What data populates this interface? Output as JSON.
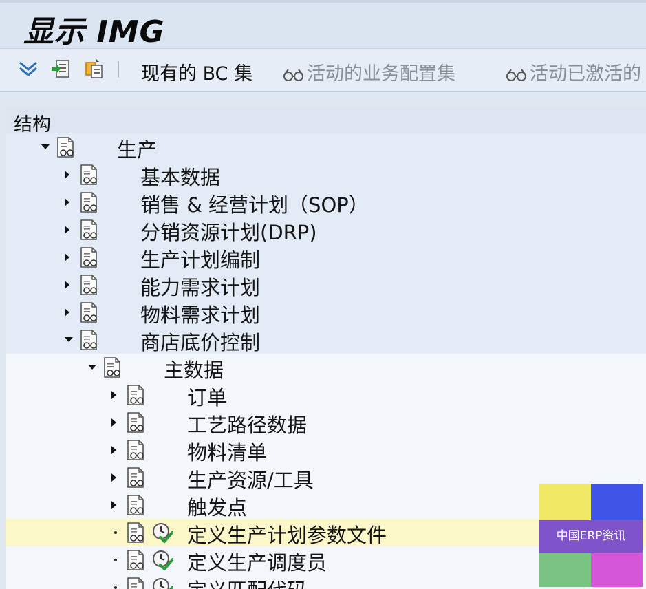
{
  "window": {
    "title": "显示 IMG"
  },
  "toolbar": {
    "existing_bc_sets": "现有的 BC 集",
    "active_business_config_sets": "活动的业务配置集",
    "activated_active": "活动已激活的"
  },
  "tree": {
    "header": "结构",
    "nodes": [
      {
        "label": "生产"
      },
      {
        "label": "基本数据"
      },
      {
        "label": "销售 & 经营计划（SOP）"
      },
      {
        "label": "分销资源计划(DRP)"
      },
      {
        "label": "生产计划编制"
      },
      {
        "label": "能力需求计划"
      },
      {
        "label": "物料需求计划"
      },
      {
        "label": "商店底价控制"
      },
      {
        "label": "主数据"
      },
      {
        "label": "订单"
      },
      {
        "label": "工艺路径数据"
      },
      {
        "label": "物料清单"
      },
      {
        "label": "生产资源/工具"
      },
      {
        "label": "触发点"
      },
      {
        "label": "定义生产计划参数文件"
      },
      {
        "label": "定义生产调度员"
      },
      {
        "label": "定义匹配代码"
      }
    ]
  },
  "watermark": {
    "text": "中国ERP资讯"
  },
  "colors": {
    "selected_row": "#fbf7c8",
    "tree_band": "#e3ecf6",
    "toolbar": "#e6edf6"
  }
}
